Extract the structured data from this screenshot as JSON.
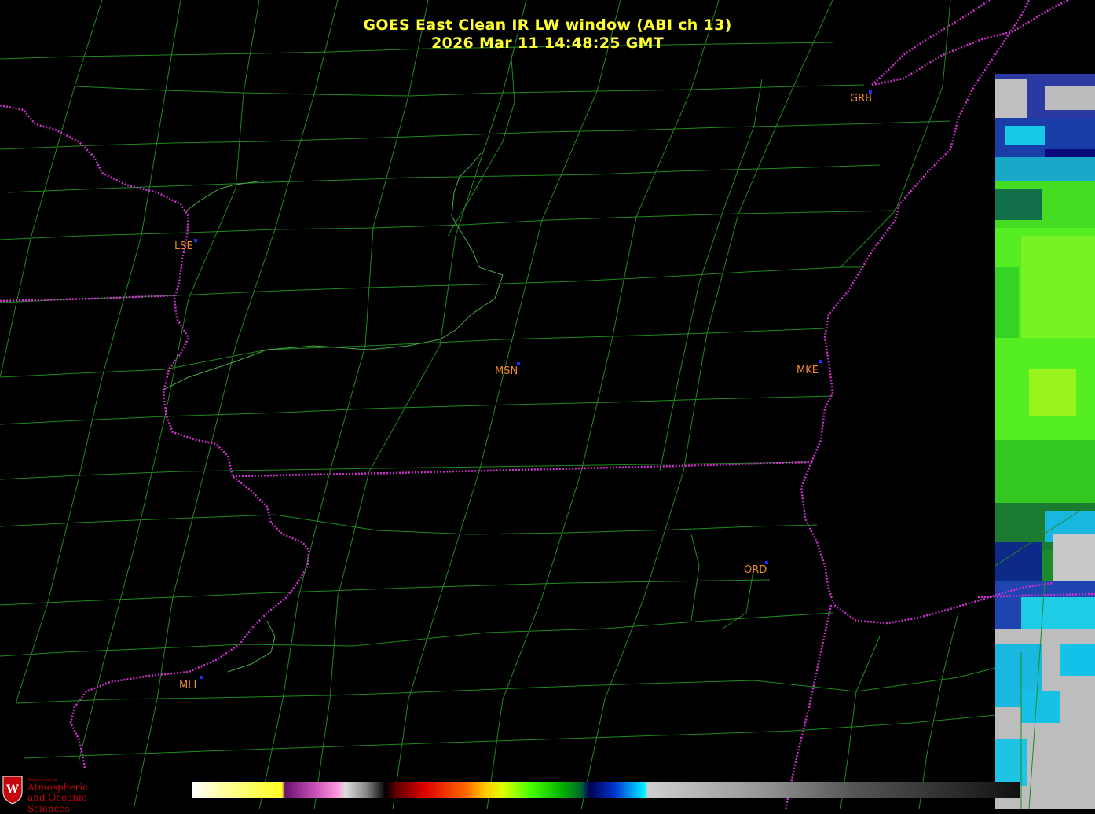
{
  "title": {
    "line1": "GOES East Clean IR LW window (ABI ch 13)",
    "line2": "2026 Mar 11  14:48:25 GMT"
  },
  "stations": [
    {
      "id": "GRB",
      "label": "GRB"
    },
    {
      "id": "LSE",
      "label": "LSE"
    },
    {
      "id": "MSN",
      "label": "MSN"
    },
    {
      "id": "MKE",
      "label": "MKE"
    },
    {
      "id": "ORD",
      "label": "ORD"
    },
    {
      "id": "MLI",
      "label": "MLI"
    }
  ],
  "logo": {
    "dept": "Department of",
    "line1": "Atmospheric",
    "line2": "and Oceanic Sciences",
    "badge_letter": "W"
  },
  "colors": {
    "background": "#000000",
    "county_lines": "#1f8a1f",
    "state_lines": "#cc33cc",
    "station_marker": "#1c2cff",
    "station_label": "#f08a24",
    "title": "#ffff33",
    "logo": "#c5050c"
  }
}
